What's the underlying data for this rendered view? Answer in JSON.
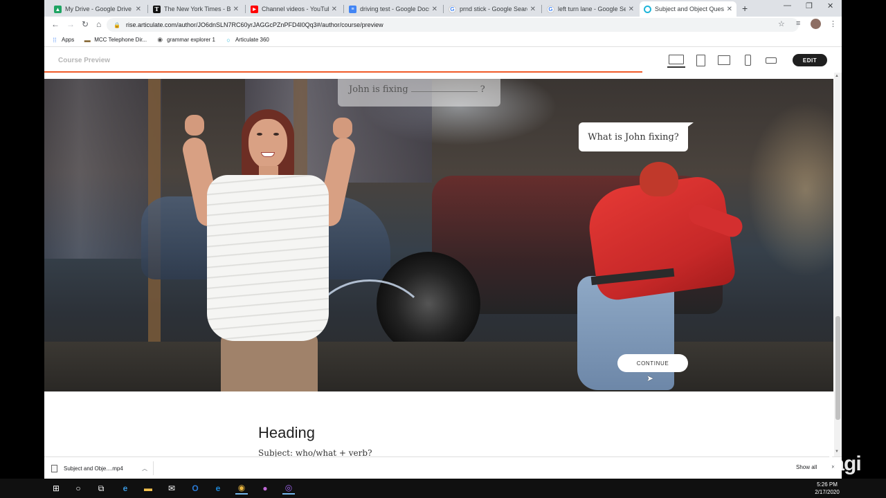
{
  "browser": {
    "tabs": [
      {
        "title": "My Drive - Google Drive",
        "icon": "google-drive-icon",
        "color": "#1fa463"
      },
      {
        "title": "The New York Times - Breaking",
        "icon": "nyt-icon",
        "color": "#111111"
      },
      {
        "title": "Channel videos - YouTube",
        "icon": "youtube-icon",
        "color": "#ff0000"
      },
      {
        "title": "driving test - Google Docs",
        "icon": "google-docs-icon",
        "color": "#4285f4"
      },
      {
        "title": "prnd stick - Google Search",
        "icon": "google-icon",
        "color": "#4285f4"
      },
      {
        "title": "left turn lane - Google Search",
        "icon": "google-icon",
        "color": "#4285f4"
      },
      {
        "title": "Subject and Object Questions",
        "icon": "articulate-icon",
        "color": "#1fb5d9",
        "active": true
      }
    ],
    "new_tab_label": "+",
    "url": "rise.articulate.com/author/JO6dnSLN7RC60yrJAGGcPZnPFD4l0Qq3#/author/course/preview",
    "bookmarks": [
      {
        "label": "Apps",
        "icon": "apps-grid-icon"
      },
      {
        "label": "MCC Telephone Dir...",
        "icon": "folder-icon"
      },
      {
        "label": "grammar explorer 1",
        "icon": "globe-icon"
      },
      {
        "label": "Articulate 360",
        "icon": "articulate-icon"
      }
    ]
  },
  "rise": {
    "course_preview_label": "Course Preview",
    "edit_label": "EDIT",
    "progress_fraction": 0.75,
    "devices": [
      "desktop",
      "tablet-portrait",
      "tablet-landscape",
      "phone-portrait",
      "phone-landscape"
    ],
    "scene": {
      "dim_bubble_text_before": "John is fixing",
      "dim_bubble_text_after": "?",
      "question_bubble": "What is John fixing?",
      "continue_label": "CONTINUE"
    },
    "heading": "Heading",
    "subheading": "Subject: who/what + verb?"
  },
  "downloads": {
    "file_name": "Subject and Obje....mp4",
    "show_all_label": "Show all"
  },
  "watermark": "lagi",
  "taskbar": {
    "time": "5:26 PM",
    "date": "2/17/2020"
  },
  "colors": {
    "accent": "#f05a28",
    "edit_button": "#1f1f1f"
  }
}
